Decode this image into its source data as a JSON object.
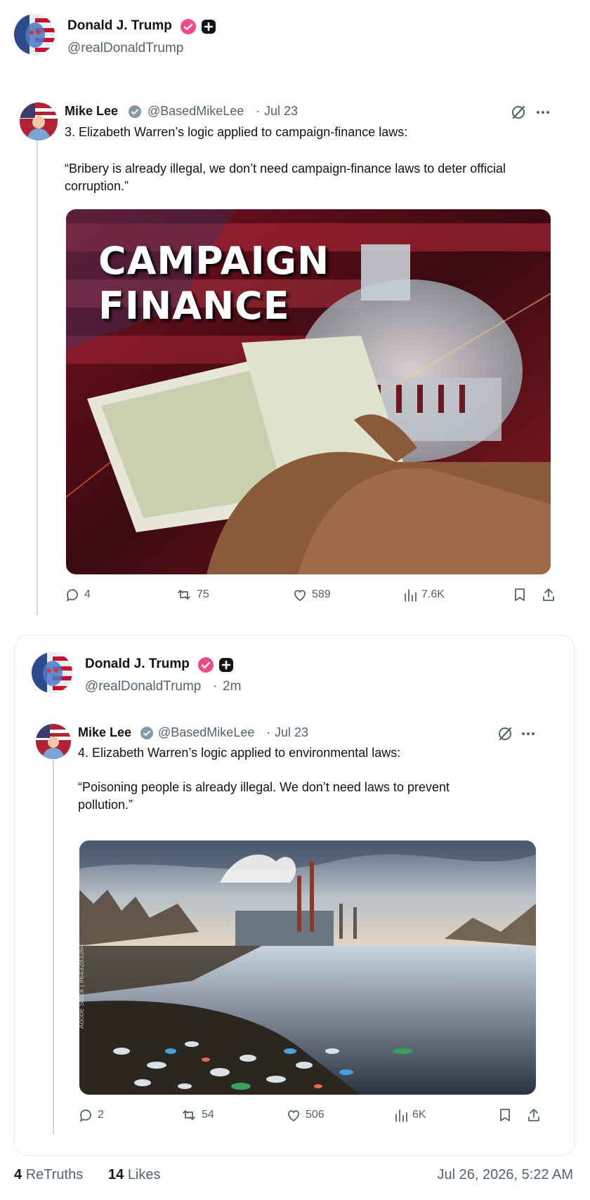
{
  "post": {
    "author_name": "Donald J. Trump",
    "author_handle": "@realDonaldTrump",
    "badge_color": "#ef4b8a"
  },
  "quote1": {
    "author_name": "Mike Lee",
    "author_handle": "@BasedMikeLee",
    "separator": "·",
    "date": "Jul 23",
    "text_line1": "3. Elizabeth Warren’s logic applied to campaign-finance laws:",
    "text_quote": "“Bribery is already illegal, we don’t need campaign-finance laws to deter official corruption.”",
    "image_caption_line1": "CAMPAIGN",
    "image_caption_line2": "FINANCE",
    "metrics": {
      "replies": "4",
      "reposts": "75",
      "likes": "589",
      "views": "7.6K"
    }
  },
  "repost_card": {
    "author_name": "Donald J. Trump",
    "author_handle": "@realDonaldTrump",
    "separator": "·",
    "time": "2m"
  },
  "quote2": {
    "author_name": "Mike Lee",
    "author_handle": "@BasedMikeLee",
    "separator": "·",
    "date": "Jul 23",
    "text_line1": "4. Elizabeth Warren’s logic applied to environmental laws:",
    "text_quote": "“Poisoning people is already illegal. We don’t need laws to prevent pollution.”",
    "image_watermark": "Adobe Stock | #643283364",
    "metrics": {
      "replies": "2",
      "reposts": "54",
      "likes": "506",
      "views": "6K"
    }
  },
  "footer": {
    "retruths_count": "4",
    "retruths_label": "ReTruths",
    "likes_count": "14",
    "likes_label": "Likes",
    "timestamp": "Jul 26, 2026, 5:22 AM"
  }
}
